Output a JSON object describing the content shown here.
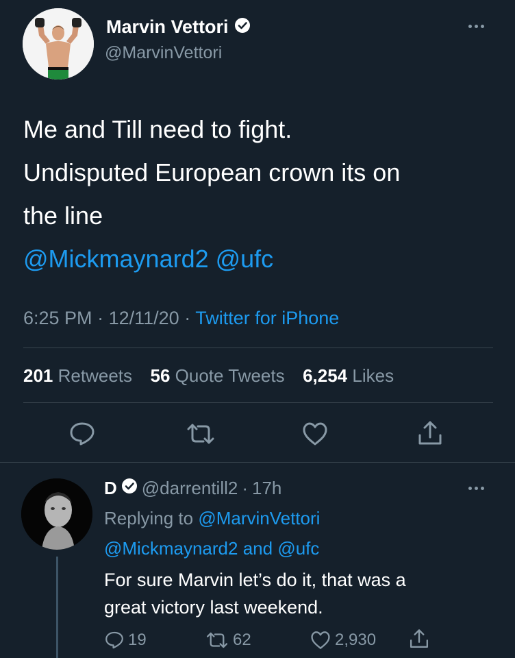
{
  "tweet": {
    "author_name": "Marvin Vettori",
    "author_handle": "@MarvinVettori",
    "text_lines": [
      "Me and Till need to fight.",
      "Undisputed European crown its on",
      "the line"
    ],
    "mentions": "@Mickmaynard2 @ufc",
    "time": "6:25 PM",
    "date": "12/11/20",
    "source": "Twitter for iPhone",
    "sep": "·",
    "stats": {
      "retweets_count": "201",
      "retweets_label": "Retweets",
      "quotes_count": "56",
      "quotes_label": "Quote Tweets",
      "likes_count": "6,254",
      "likes_label": "Likes"
    },
    "actions": [
      "reply-icon",
      "retweet-icon",
      "like-icon",
      "share-icon"
    ]
  },
  "reply": {
    "author_name": "D",
    "author_handle": "@darrentill2",
    "time": "17h",
    "sep": "·",
    "replying_to_label": "Replying to",
    "replying_to_user": "@MarvinVettori",
    "replying_to_user2": "@Mickmaynard2",
    "replying_and": "and",
    "replying_to_user3": "@ufc",
    "text_lines": [
      "For sure Marvin let’s do it, that was a",
      "great victory last weekend."
    ],
    "reply_count": "19",
    "retweet_count": "62",
    "like_count": "2,930"
  },
  "colors": {
    "background": "#15202b",
    "link": "#1d9bf0",
    "muted": "#8899a6",
    "divider": "#38444d"
  }
}
